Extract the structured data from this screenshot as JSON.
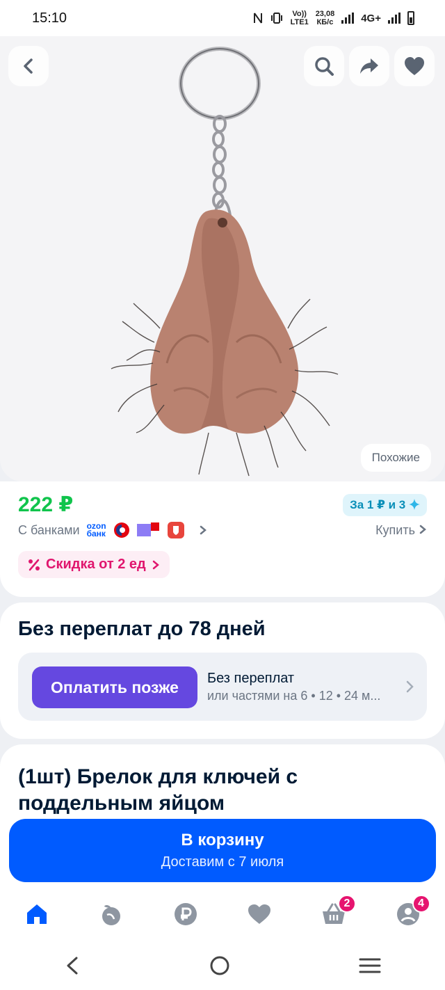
{
  "status_bar": {
    "time": "15:10",
    "data_rate_value": "23,08",
    "data_rate_unit": "КБ/с",
    "network": "4G+",
    "volte": "Vo))",
    "lte": "LTE1"
  },
  "image_area": {
    "similar_label": "Похожие",
    "icons": [
      "back-icon",
      "search-icon",
      "share-icon",
      "heart-icon"
    ]
  },
  "price_card": {
    "price": "222 ₽",
    "points": "За 1 ₽ и 3",
    "banks_label": "С банками",
    "ozon_bank": [
      "ozon",
      "банк"
    ],
    "buy_label": "Купить",
    "discount": "Скидка от 2 ед"
  },
  "installment": {
    "title": "Без переплат до 78 дней",
    "button": "Оплатить позже",
    "line1": "Без переплат",
    "line2": "или частями на 6 • 12 • 24 м..."
  },
  "product": {
    "title": "(1шт) Брелок для ключей с поддельным яйцом"
  },
  "cart": {
    "label": "В корзину",
    "delivery": "Доставим с 7 июля"
  },
  "bottom_nav": {
    "items": [
      "home-icon",
      "fresh-icon",
      "ruble-icon",
      "favorites-icon",
      "cart-icon",
      "profile-icon"
    ],
    "cart_badge": "2",
    "profile_badge": "4",
    "accent": "#005bff"
  },
  "colors": {
    "brand": "#005bff",
    "price_green": "#10c44c",
    "discount_pink": "#e0166e",
    "pay_later_purple": "#6548e0"
  }
}
